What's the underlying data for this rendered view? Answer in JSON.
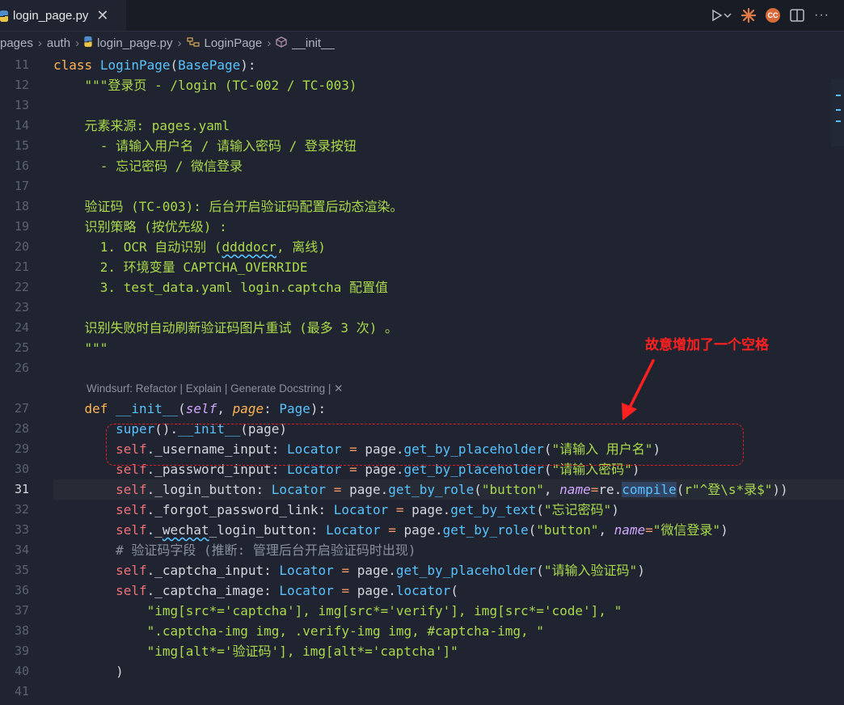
{
  "tab": {
    "title": "login_page.py",
    "close": "✕"
  },
  "breadcrumb": [
    "pages",
    "auth",
    "login_page.py",
    "LoginPage",
    "__init__"
  ],
  "codelens": "Windsurf: Refactor | Explain | Generate Docstring | ✕",
  "annotation": "故意增加了一个空格",
  "active_line": "31",
  "line_numbers": [
    "11",
    "12",
    "13",
    "14",
    "15",
    "16",
    "17",
    "18",
    "19",
    "20",
    "21",
    "22",
    "23",
    "24",
    "25",
    "26",
    "27",
    "28",
    "29",
    "30",
    "31",
    "32",
    "33",
    "34",
    "35",
    "36",
    "37",
    "38",
    "39",
    "40",
    "41"
  ],
  "colors": {
    "background": "#1f2430",
    "annotation": "#ff2020",
    "string": "#aad94c",
    "self": "#f07178",
    "function": "#59c2ff",
    "keyword": "#ffb454"
  }
}
